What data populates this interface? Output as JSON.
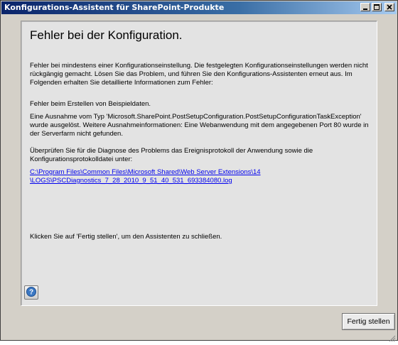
{
  "window": {
    "title": "Konfigurations-Assistent für SharePoint-Produkte"
  },
  "panel": {
    "heading": "Fehler bei der Konfiguration.",
    "intro": "Fehler bei mindestens einer Konfigurationseinstellung. Die festgelegten Konfigurationseinstellungen werden nicht rückgängig gemacht. Lösen Sie das Problem, und führen Sie den Konfigurations-Assistenten erneut aus. Im Folgenden erhalten Sie detaillierte Informationen zum Fehler:",
    "error_summary": "Fehler beim Erstellen von Beispieldaten.",
    "exception": "Eine Ausnahme vom Typ 'Microsoft.SharePoint.PostSetupConfiguration.PostSetupConfigurationTaskException' wurde ausgelöst. Weitere Ausnahmeinformationen: Eine Webanwendung mit dem angegebenen Port 80 wurde in der Serverfarm nicht gefunden.",
    "diagnosis": "Überprüfen Sie für die Diagnose des Problems das Ereignisprotokoll der Anwendung sowie die Konfigurationsprotokolldatei unter:",
    "log_link_line1": "C:\\Program Files\\Common Files\\Microsoft Shared\\Web Server Extensions\\14",
    "log_link_line2": "\\LOGS\\PSCDiagnostics_7_28_2010_9_51_40_531_693384080.log",
    "closing": "Klicken Sie auf 'Fertig stellen', um den Assistenten zu schließen."
  },
  "buttons": {
    "finish": "Fertig stellen",
    "help_icon": "question-icon"
  },
  "titlebar_buttons": [
    "minimize-icon",
    "maximize-icon",
    "close-icon"
  ],
  "colors": {
    "titlebar_start": "#0a246a",
    "titlebar_end": "#a6caf0",
    "link": "#0000ee",
    "help_icon": "#3b78c4"
  }
}
